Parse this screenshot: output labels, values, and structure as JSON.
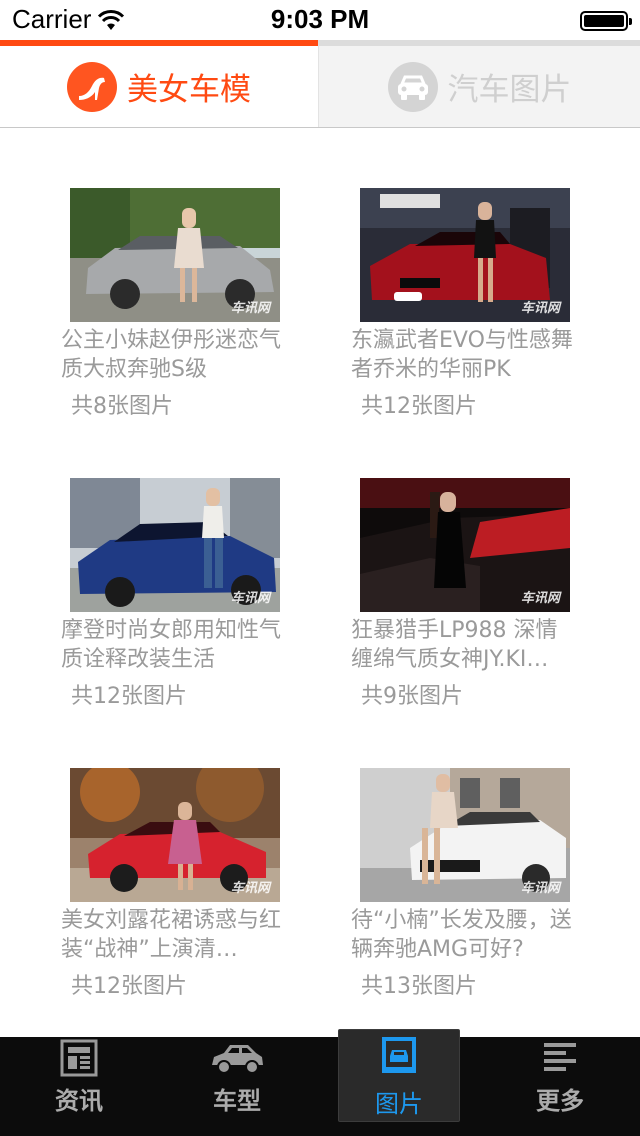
{
  "status_bar": {
    "carrier": "Carrier",
    "time": "9:03 PM"
  },
  "segment_tabs": [
    {
      "label": "美女车模",
      "icon": "high-heel-icon",
      "active": true
    },
    {
      "label": "汽车图片",
      "icon": "car-front-icon",
      "active": false
    }
  ],
  "cards": [
    {
      "title": "公主小妹赵伊彤迷恋气质大叔奔驰S级",
      "count": "共8张图片",
      "watermark": "车讯网"
    },
    {
      "title": "东瀛武者EVO与性感舞者乔米的华丽PK",
      "count": "共12张图片",
      "watermark": "车讯网"
    },
    {
      "title": "摩登时尚女郎用知性气质诠释改装生活",
      "count": "共12张图片",
      "watermark": "车讯网"
    },
    {
      "title": "狂暴猎手LP988 深情缠绵气质女神JY.KI…",
      "count": "共9张图片",
      "watermark": "车讯网"
    },
    {
      "title": "美女刘露花裙诱惑与红装“战神”上演清…",
      "count": "共12张图片",
      "watermark": "车讯网"
    },
    {
      "title": "待“小楠”长发及腰，送辆奔驰AMG可好?",
      "count": "共13张图片",
      "watermark": "车讯网"
    }
  ],
  "tab_bar": [
    {
      "label": "资讯",
      "icon": "news-icon",
      "selected": false
    },
    {
      "label": "车型",
      "icon": "car-icon",
      "selected": false
    },
    {
      "label": "图片",
      "icon": "picture-icon",
      "selected": true
    },
    {
      "label": "更多",
      "icon": "more-icon",
      "selected": false
    }
  ],
  "colors": {
    "accent": "#ff4a12",
    "tab_selected": "#1d98ee",
    "text_muted": "#9a9a9a",
    "tab_bar_bg": "#0c0c0c"
  }
}
